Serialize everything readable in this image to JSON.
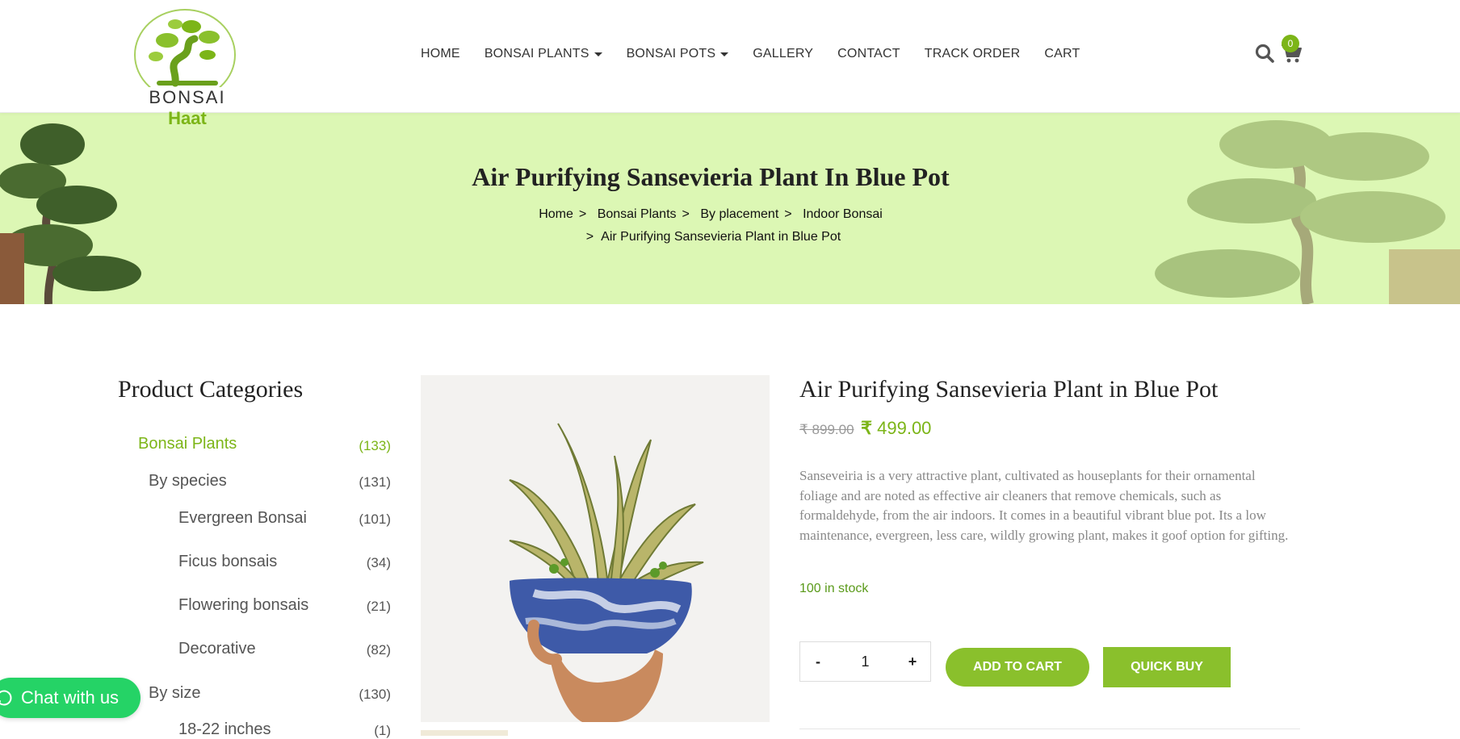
{
  "logo": {
    "word1": "BONSAI",
    "word2": "Haat"
  },
  "nav": {
    "items": [
      "HOME",
      "BONSAI PLANTS",
      "BONSAI POTS",
      "GALLERY",
      "CONTACT",
      "TRACK ORDER",
      "CART"
    ]
  },
  "cart": {
    "count": "0"
  },
  "banner": {
    "title": "Air Purifying Sansevieria Plant In Blue Pot",
    "breadcrumb": [
      "Home",
      "Bonsai Plants",
      "By placement",
      "Indoor Bonsai",
      "Air Purifying Sansevieria Plant in Blue Pot"
    ]
  },
  "sidebar": {
    "title": "Product Categories",
    "categories": [
      {
        "label": "Bonsai Plants",
        "count": "(133)"
      },
      {
        "label": "By species",
        "count": "(131)"
      },
      {
        "label": "Evergreen Bonsai",
        "count": "(101)"
      },
      {
        "label": "Ficus bonsais",
        "count": "(34)"
      },
      {
        "label": "Flowering bonsais",
        "count": "(21)"
      },
      {
        "label": "Decorative",
        "count": "(82)"
      },
      {
        "label": "By size",
        "count": "(130)"
      },
      {
        "label": "18-22 inches",
        "count": "(1)"
      }
    ]
  },
  "product": {
    "title": "Air Purifying Sansevieria Plant in Blue Pot",
    "old_price": "₹ 899.00",
    "new_price_symbol": "₹",
    "new_price": "499.00",
    "description": "Sanseveiria is a very attractive plant, cultivated as houseplants for their ornamental foliage and are noted as effective air cleaners that remove chemicals, such as formaldehyde, from the air indoors. It comes in a beautiful vibrant blue pot. Its a low maintenance, evergreen, less care, wildly growing plant, makes it goof option for gifting.",
    "stock": "100 in stock",
    "qty_minus": "-",
    "qty_value": "1",
    "qty_plus": "+",
    "add_to_cart": "ADD TO CART",
    "quick_buy": "QUICK BUY"
  },
  "chat": {
    "label": "Chat with us"
  },
  "colors": {
    "accent": "#7cb518",
    "button": "#8ac02c",
    "banner": "#dcf7b4",
    "whatsapp": "#25d366"
  }
}
